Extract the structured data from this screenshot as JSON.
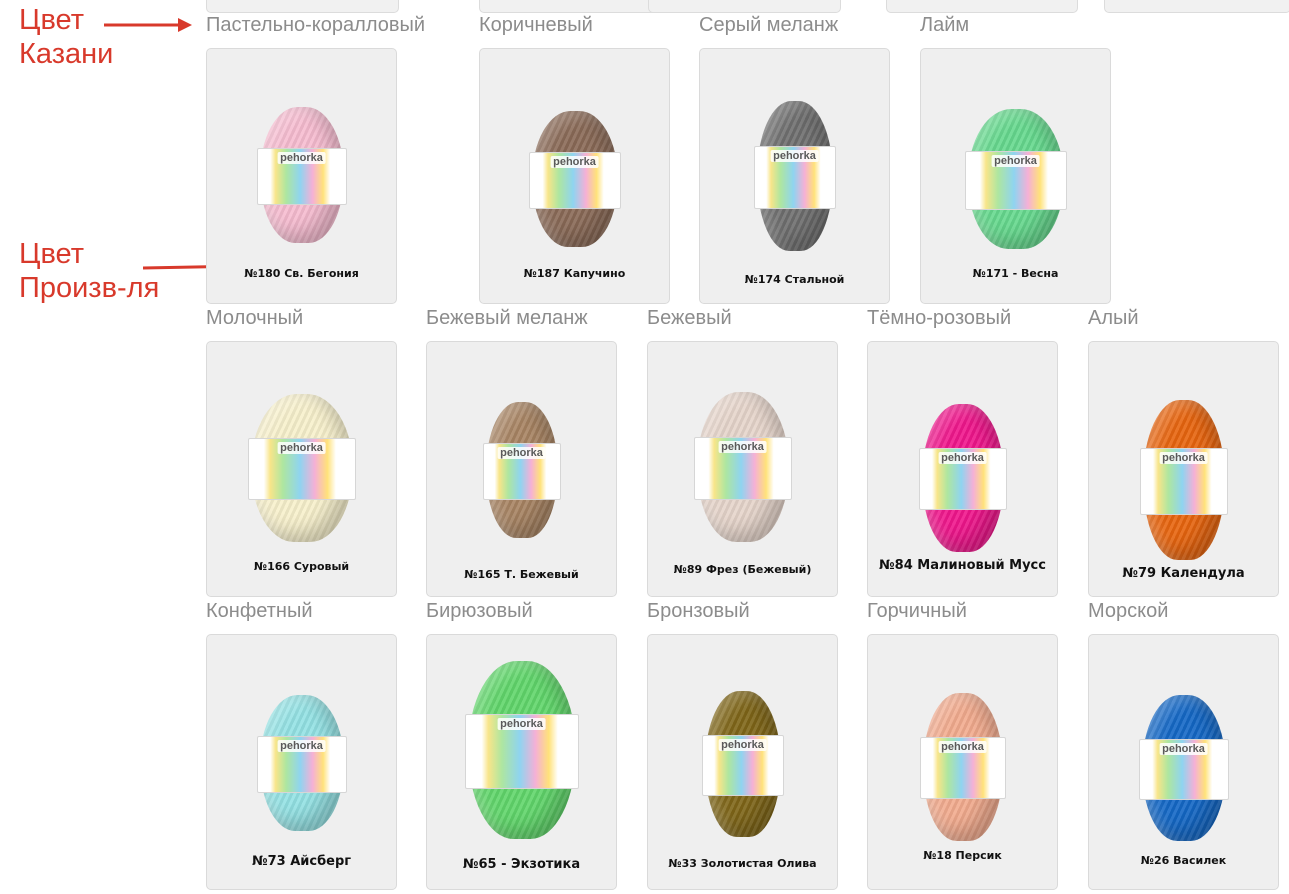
{
  "annotations": {
    "kazan_label": "Цвет\nКазани",
    "manufacturer_label": "Цвет\nПроизв-ля"
  },
  "brand": "pehorka",
  "rows": [
    [
      {
        "name": "Пастельно-коралловый",
        "code": "№180  Св. Бегония",
        "color": "#f6bcd0"
      },
      {
        "name": "Коричневый",
        "code": "№187  Капучино",
        "color": "#8a6a57"
      },
      {
        "name": "Серый меланж",
        "code": "№174  Стальной",
        "color": "#6f6f6f"
      },
      {
        "name": "Лайм",
        "code": "№171  - Весна",
        "color": "#66d98e"
      }
    ],
    [
      {
        "name": "Молочный",
        "code": "№166  Суровый",
        "color": "#f7f0cc"
      },
      {
        "name": "Бежевый меланж",
        "code": "№165  Т. Бежевый",
        "color": "#a88463"
      },
      {
        "name": "Бежевый",
        "code": "№89  Фрез (Бежевый)",
        "color": "#e6d5cb"
      },
      {
        "name": "Тёмно-розовый",
        "code": "№84  Малиновый Мусс",
        "color": "#f0168c"
      },
      {
        "name": "Алый",
        "code": "№79  Календула",
        "color": "#e8650f"
      }
    ],
    [
      {
        "name": "Конфетный",
        "code": "№73  Айсберг",
        "color": "#94e2e4"
      },
      {
        "name": "Бирюзовый",
        "code": "№65 - Экзотика",
        "color": "#61d66b"
      },
      {
        "name": "Бронзовый",
        "code": "№33  Золотистая Олива",
        "color": "#7f6618"
      },
      {
        "name": "Горчичный",
        "code": "№18  Персик",
        "color": "#f2ab8e"
      },
      {
        "name": "Морской",
        "code": "№26  Василек",
        "color": "#1468c6"
      }
    ]
  ],
  "colors": {
    "annotation": "#d8392b",
    "name_text": "#8c8c8c",
    "card_bg": "#efefef"
  }
}
